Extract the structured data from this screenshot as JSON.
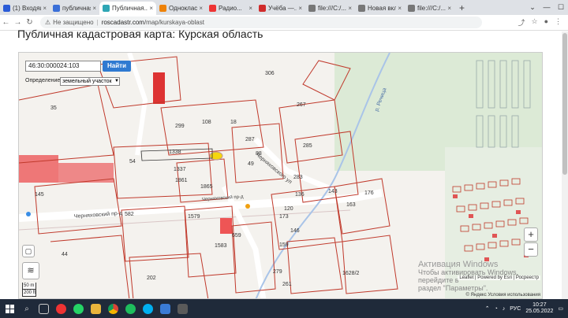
{
  "browser": {
    "tabs": [
      {
        "label": "(1) Входящ...",
        "color": "#2a5bd7",
        "active": false
      },
      {
        "label": "публичная...",
        "color": "#3a6fd8",
        "active": false
      },
      {
        "label": "Публичная...",
        "color": "#2ea6b5",
        "active": true
      },
      {
        "label": "Одноклас...",
        "color": "#ee8208",
        "active": false
      },
      {
        "label": "Радио...",
        "color": "#e33",
        "active": false
      },
      {
        "label": "Учёба —...",
        "color": "#d02b2b",
        "active": false
      },
      {
        "label": "file:///C:/...",
        "color": "#777",
        "active": false
      },
      {
        "label": "Новая вкл...",
        "color": "#777",
        "active": false
      },
      {
        "label": "file:///C:/...",
        "color": "#777",
        "active": false
      }
    ],
    "security_label": "Не защищено",
    "url_host": "roscadastr.com",
    "url_path": "/map/kurskaya-oblast"
  },
  "page": {
    "title": "Публичная кадастровая карта: Курская область",
    "search_value": "46:30:000024:103",
    "find_label": "Найти",
    "definition_label": "Определение:",
    "definition_value": "земельный участок",
    "scale_m": "50 m",
    "scale_ft": "200 ft",
    "attribution": "Leaflet | Powered by Esri | Росреестр",
    "yandex": "© Яндекс  Условия использования",
    "activation_line1": "Активация Windows",
    "activation_line2": "Чтобы активировать Windows, перейдите в",
    "activation_line3": "раздел \"Параметры\"."
  },
  "map_labels": {
    "street1": "Черняховский пр-д",
    "street2": "Черняховского ул",
    "street3": "Черняховский пр-д",
    "street4": "р. Речица",
    "parcels": [
      "35",
      "145",
      "54",
      "299",
      "108",
      "18",
      "267",
      "285",
      "287",
      "88",
      "163",
      "176",
      "136",
      "143",
      "283",
      "173",
      "146",
      "159",
      "120",
      "1338",
      "1337",
      "1861",
      "1865",
      "49",
      "582",
      "1579",
      "659",
      "1583",
      "1628/2",
      "279",
      "261",
      "202",
      "44",
      "306"
    ]
  },
  "taskbar": {
    "time": "10:27",
    "date": "25.05.2022",
    "lang": "РУС"
  }
}
